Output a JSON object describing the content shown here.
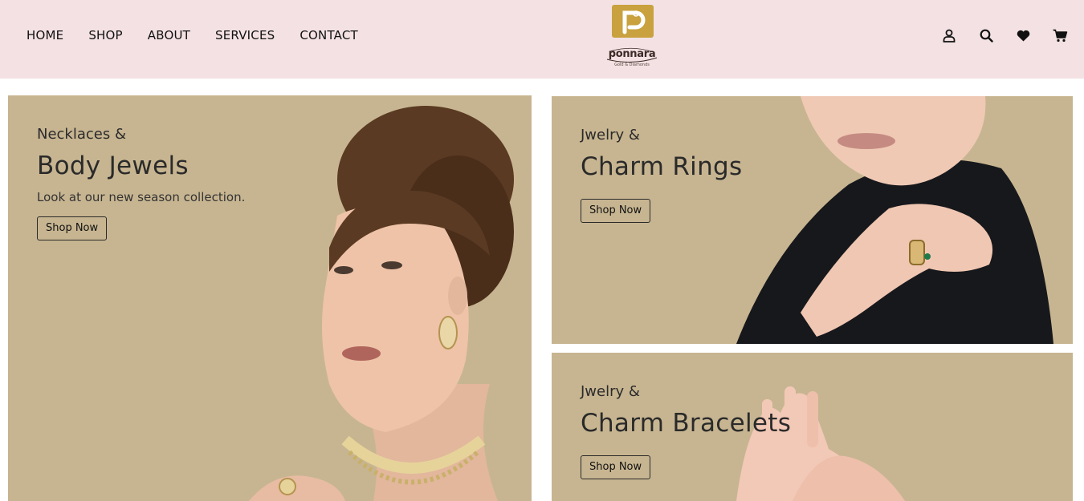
{
  "nav": {
    "items": [
      "HOME",
      "SHOP",
      "ABOUT",
      "SERVICES",
      "CONTACT"
    ]
  },
  "brand": {
    "name": "ponnara",
    "tagline": "Gold & Diamonds",
    "logo_color": "#c9a23f"
  },
  "header_icons": [
    "user-icon",
    "search-icon",
    "heart-icon",
    "cart-icon"
  ],
  "colors": {
    "header_bg": "#f3e1e3",
    "panel_bg": "#c7b591"
  },
  "banners": [
    {
      "kicker": "Necklaces &",
      "title": "Body Jewels",
      "subtitle": "Look at our new season collection.",
      "button": "Shop Now"
    },
    {
      "kicker": "Jwelry &",
      "title": "Charm Rings",
      "button": "Shop Now"
    },
    {
      "kicker": "Jwelry &",
      "title": "Charm Bracelets",
      "button": "Shop Now"
    }
  ]
}
